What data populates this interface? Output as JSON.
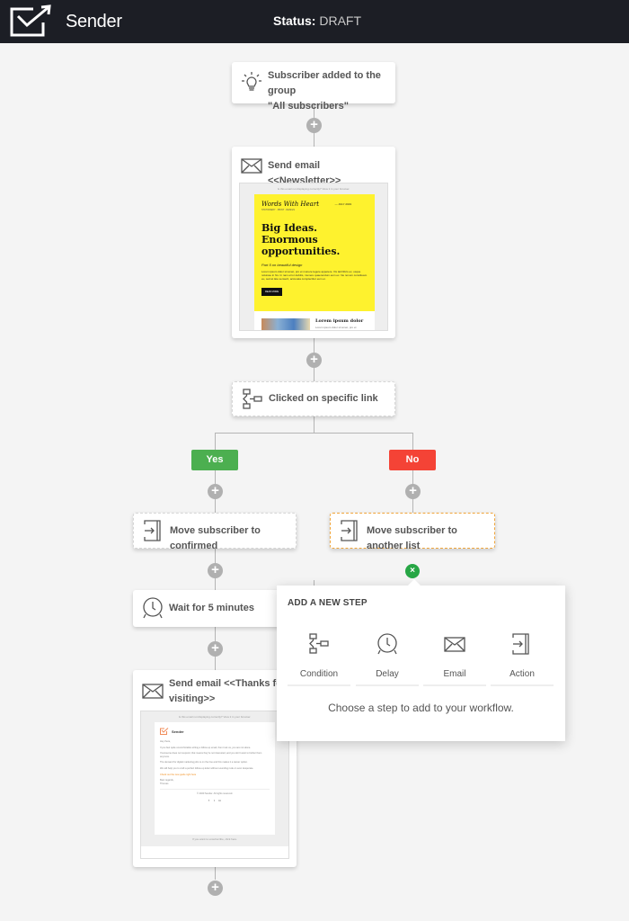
{
  "header": {
    "brand": "Sender",
    "status_label": "Status:",
    "status_value": "DRAFT",
    "logo_icon": "envelope-check-arrow-icon"
  },
  "workflow": {
    "trigger": {
      "icon": "lightbulb-icon",
      "line1": "Subscriber added to the group",
      "line2": "\"All subscribers\""
    },
    "send_newsletter": {
      "icon": "envelope-icon",
      "label": "Send email <<Newsletter>>",
      "preview": {
        "top_note": "Is this email not displaying correctly? View it in your browser.",
        "brand_script": "Words With Heart",
        "brand_sub": "STATIONERY · PRINT · DESIGN",
        "date": "— JULY 2019",
        "headline": "Big Ideas. Enormous opportunities.",
        "subhead": "Part 5 on beautiful design",
        "body": "Lorem ipsum dolor sit amet, pro et munere legere appetere. Vix latil libris ex, usque noluisse in his. In nam error debitis, munere quaerendum eum ex. Ne novum constituam eu, sed at late senserit, accusata complectitur eum ei.",
        "cta": "READ MORE",
        "card_title": "Lorem ipsum dolor",
        "card_text": "Lorem ipsum dolor sit amet, pro et"
      }
    },
    "condition": {
      "icon": "condition-flow-icon",
      "label": "Clicked on specific link"
    },
    "yes_label": "Yes",
    "no_label": "No",
    "yes_branch": {
      "move": {
        "icon": "move-to-list-icon",
        "label": "Move subscriber to confirmed"
      },
      "wait": {
        "icon": "clock-icon",
        "label": "Wait for 5 minutes"
      },
      "send": {
        "icon": "envelope-icon",
        "label_line1": "Send email <<Thanks for",
        "label_line2": "visiting>>",
        "preview": {
          "top_note": "Is this email not displaying correctly? View it in your browser.",
          "brand": "Sender",
          "greeting": "Hey there,",
          "p1": "If you feel quite uncomfortable writing a follow-up email, then trust us, you are not alone.",
          "p2": "If someone does not respond, that means they're not interested, and you don't want to bother them anymore.",
          "p3": "The demand for digital marketing jobs is on the rise and this makes it a career option.",
          "p4": "We will help you to craft a perfect follow-up letter without sounding rude or even desperate.",
          "link": "Check out the new guide right here",
          "signoff1": "Best regards,",
          "signoff2": "Thomas",
          "footer": "© 2020 Sender. All rights reserved.",
          "social": [
            "f",
            "t",
            "in"
          ],
          "bottom_note": "If you want to unsubscribe, click here."
        }
      }
    },
    "no_branch": {
      "move": {
        "icon": "move-to-list-icon",
        "label": "Move subscriber to another list"
      }
    }
  },
  "add_step_popover": {
    "title": "ADD A NEW STEP",
    "options": [
      {
        "label": "Condition",
        "icon": "condition-flow-icon"
      },
      {
        "label": "Delay",
        "icon": "clock-icon"
      },
      {
        "label": "Email",
        "icon": "envelope-icon"
      },
      {
        "label": "Action",
        "icon": "move-to-list-icon"
      }
    ],
    "hint": "Choose a step to add to your workflow.",
    "close_symbol": "×"
  },
  "plus_symbol": "+",
  "colors": {
    "yes": "#4caf50",
    "no": "#f44336",
    "active_border": "#f0a53b",
    "close": "#27a645",
    "topbar": "#1c1e25",
    "email_yellow": "#fef22e",
    "sender_orange": "#f08c5a"
  }
}
